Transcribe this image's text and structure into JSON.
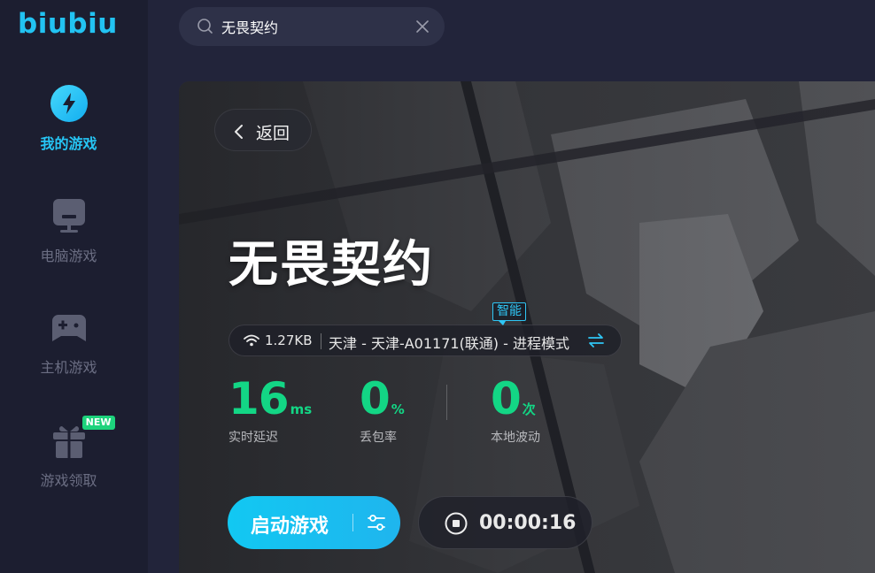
{
  "app": {
    "logo": "biubiu"
  },
  "sidebar": {
    "items": [
      {
        "label": "我的游戏",
        "icon": "lightning-icon",
        "active": true
      },
      {
        "label": "电脑游戏",
        "icon": "monitor-icon",
        "active": false
      },
      {
        "label": "主机游戏",
        "icon": "gamepad-icon",
        "active": false
      },
      {
        "label": "游戏领取",
        "icon": "gift-icon",
        "active": false,
        "badge": "NEW"
      }
    ]
  },
  "search": {
    "value": "无畏契约"
  },
  "hero": {
    "back_label": "返回",
    "game_title": "无畏契约",
    "smart_tag": "智能",
    "speed": "1.27KB",
    "route": "天津 - 天津-A01171(联通) - 进程模式",
    "stats": [
      {
        "value": "16",
        "unit": "ms",
        "label": "实时延迟"
      },
      {
        "value": "0",
        "unit": "%",
        "label": "丢包率"
      },
      {
        "value": "0",
        "unit": "次",
        "label": "本地波动"
      }
    ],
    "launch_label": "启动游戏",
    "timer": "00:00:16"
  },
  "colors": {
    "accent": "#22c3f2",
    "success": "#13d685",
    "sidebar_bg": "#1c1e30",
    "page_bg": "#22243a"
  }
}
